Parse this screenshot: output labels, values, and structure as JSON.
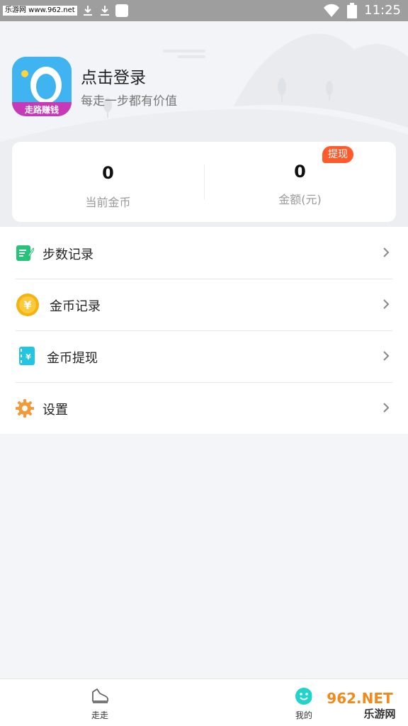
{
  "status_bar": {
    "site_label": "乐游网 www.962.net",
    "time": "11:25"
  },
  "profile": {
    "title": "点击登录",
    "subtitle": "每走一步都有价值",
    "avatar_text": "走路赚钱"
  },
  "stats": {
    "coins_value": "0",
    "coins_label": "当前金币",
    "amount_value": "0",
    "amount_label": "金额(元)",
    "withdraw_badge": "提现"
  },
  "menu": {
    "items": [
      {
        "label": "步数记录",
        "icon": "notepad-icon"
      },
      {
        "label": "金币记录",
        "icon": "yuan-coin-icon"
      },
      {
        "label": "金币提现",
        "icon": "wallet-yuan-icon"
      },
      {
        "label": "设置",
        "icon": "gear-icon"
      }
    ]
  },
  "bottom_nav": {
    "items": [
      {
        "label": "走走",
        "icon": "sneaker-icon"
      },
      {
        "label": "我的",
        "icon": "smiley-icon"
      }
    ]
  },
  "watermark": {
    "text_top": "962.NET",
    "text_bottom": "乐游网"
  },
  "colors": {
    "accent_orange": "#ff5a2b",
    "icon_green": "#25c47a",
    "coin_gold": "#f5b312",
    "wallet_cyan": "#21c6e4",
    "gear_orange": "#f29a3a",
    "nav_active": "#23d2c8"
  }
}
